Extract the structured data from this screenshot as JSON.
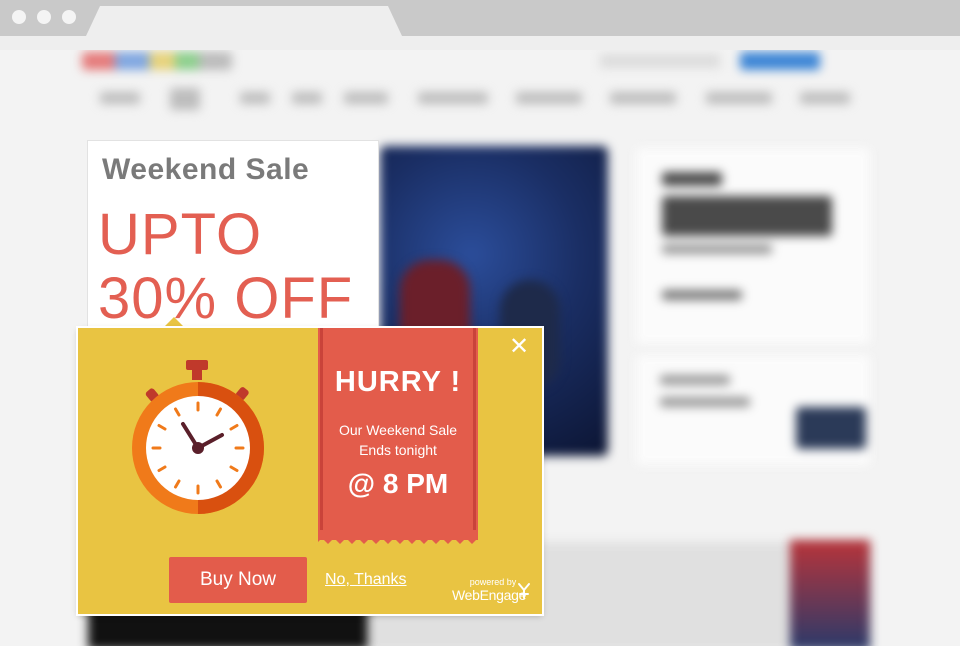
{
  "sale_card": {
    "title": "Weekend Sale",
    "line1": "UPTO",
    "line2": "30% OFF"
  },
  "popup": {
    "close_label": "✕",
    "headline": "HURRY !",
    "message_line1": "Our Weekend Sale",
    "message_line2": "Ends tonight",
    "time": "@ 8 PM",
    "buy_button": "Buy Now",
    "dismiss_link": "No, Thanks",
    "powered_by": "powered by",
    "brand": "WebEngage"
  },
  "colors": {
    "popup_background": "#e9c442",
    "accent_red": "#e35c4b",
    "clock_orange": "#f07a1a",
    "clock_dark_orange": "#d9500f",
    "sale_text_red": "#e35f52"
  },
  "icons": {
    "clock": "stopwatch-icon",
    "close": "close-icon",
    "brand_logo": "webengage-logo-icon"
  }
}
